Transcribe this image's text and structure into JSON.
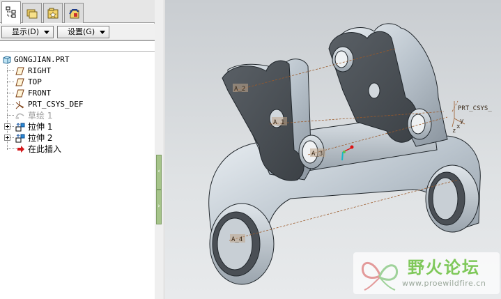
{
  "tabs": [
    {
      "name": "model-tree-tab",
      "icon": "model-tree-icon",
      "active": true
    },
    {
      "name": "folder-browser-tab",
      "icon": "folder-icon",
      "active": false
    },
    {
      "name": "favorites-tab",
      "icon": "favorites-icon",
      "active": false
    },
    {
      "name": "connections-tab",
      "icon": "connections-icon",
      "active": false
    }
  ],
  "toolbar": {
    "show_label": "显示(D)",
    "settings_label": "设置(G)"
  },
  "tree": {
    "root": "GONGJIAN.PRT",
    "items": [
      {
        "label": "RIGHT",
        "icon": "datum-plane-icon"
      },
      {
        "label": "TOP",
        "icon": "datum-plane-icon"
      },
      {
        "label": "FRONT",
        "icon": "datum-plane-icon"
      },
      {
        "label": "PRT_CSYS_DEF",
        "icon": "csys-icon"
      },
      {
        "label": "草绘 1",
        "icon": "sketch-icon",
        "state": "suppressed"
      },
      {
        "label": "拉伸 1",
        "icon": "extrude-icon"
      },
      {
        "label": "拉伸 2",
        "icon": "extrude-icon"
      },
      {
        "label": "在此插入",
        "icon": "insert-here-arrow-icon"
      }
    ]
  },
  "viewport": {
    "dimension_labels": [
      "A_2",
      "A_1",
      "A_3",
      "A_4"
    ],
    "csys_label": "PRT_CSYS_",
    "axis_labels": [
      "y",
      "x",
      "z"
    ]
  },
  "watermark": {
    "name_cn": "野火论坛",
    "url": "www.proewildfire.cn"
  },
  "colors": {
    "accent_green": "#7fc85a",
    "sash_green": "#a6c48a",
    "model_dark": "#4a4f55",
    "model_light": "#b7c0c9"
  }
}
